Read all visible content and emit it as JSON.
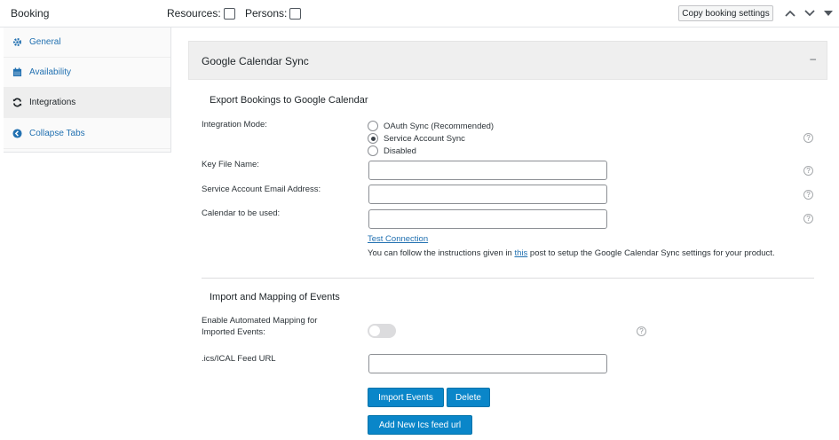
{
  "header": {
    "title": "Booking",
    "resources_label": "Resources:",
    "persons_label": "Persons:",
    "copy_button": "Copy booking settings"
  },
  "sidebar": {
    "items": [
      {
        "label": "General",
        "icon": "gear-icon"
      },
      {
        "label": "Availability",
        "icon": "calendar-icon"
      },
      {
        "label": "Integrations",
        "icon": "sync-icon"
      },
      {
        "label": "Collapse Tabs",
        "icon": "chevron-left-circle-icon"
      }
    ]
  },
  "panel": {
    "title": "Google Calendar Sync",
    "collapse_symbol": "–"
  },
  "export": {
    "title": "Export Bookings to Google Calendar",
    "integration_mode_label": "Integration Mode:",
    "modes": [
      "OAuth Sync (Recommended)",
      "Service Account Sync",
      "Disabled"
    ],
    "selected_mode": "Service Account Sync",
    "key_file_label": "Key File Name:",
    "service_email_label": "Service Account Email Address:",
    "calendar_label": "Calendar to be used:",
    "test_connection": "Test Connection",
    "note_before": "You can follow the instructions given in ",
    "note_link": "this",
    "note_after": " post to setup the Google Calendar Sync settings for your product."
  },
  "import": {
    "title": "Import and Mapping of Events",
    "automated_mapping_label": "Enable Automated Mapping for Imported Events:",
    "automated_mapping_enabled": false,
    "feed_url_label": ".ics/ICAL Feed URL",
    "import_button": "Import Events",
    "delete_button": "Delete",
    "add_button": "Add New Ics feed url"
  },
  "help_symbol": "?",
  "colors": {
    "primary_button": "#0a86c9",
    "link": "#2271b1",
    "panel_header": "#efefef"
  }
}
